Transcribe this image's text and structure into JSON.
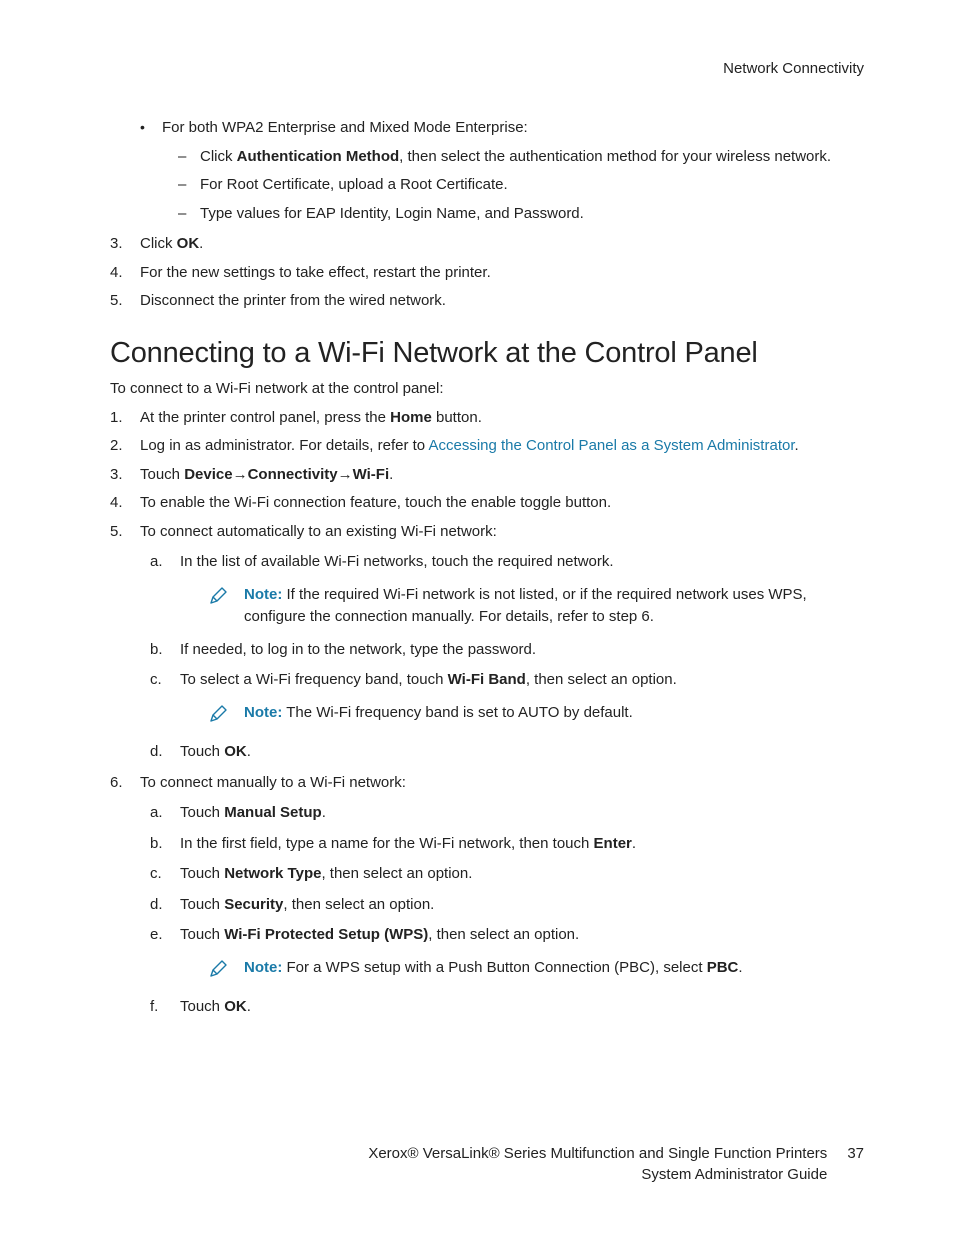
{
  "header": {
    "section": "Network Connectivity"
  },
  "top": {
    "bullet_intro": "For both WPA2 Enterprise and Mixed Mode Enterprise:",
    "dash": {
      "d1a": "Click ",
      "d1b": "Authentication Method",
      "d1c": ", then select the authentication method for your wireless network.",
      "d2": "For Root Certificate, upload a Root Certificate.",
      "d3": "Type values for EAP Identity, Login Name, and Password."
    },
    "n3a": "Click ",
    "n3b": "OK",
    "n3c": ".",
    "n4": "For the new settings to take effect, restart the printer.",
    "n5": "Disconnect the printer from the wired network."
  },
  "section": {
    "title": "Connecting to a Wi-Fi Network at the Control Panel",
    "intro": "To connect to a Wi-Fi network at the control panel:",
    "s1a": "At the printer control panel, press the ",
    "s1b": "Home",
    "s1c": " button.",
    "s2a": "Log in as administrator. For details, refer to ",
    "s2link": "Accessing the Control Panel as a System Administrator",
    "s2b": ".",
    "s3a": "Touch ",
    "s3b": "Device→Connectivity→Wi-Fi",
    "s3c": ".",
    "s4": "To enable the Wi-Fi connection feature, touch the enable toggle button.",
    "s5": "To connect automatically to an existing Wi-Fi network:",
    "s5a": "In the list of available Wi-Fi networks, touch the required network.",
    "note1_label": "Note:",
    "note1_text": " If the required Wi-Fi network is not listed, or if the required network uses WPS, configure the connection manually. For details, refer to step 6.",
    "s5b": "If needed, to log in to the network, type the password.",
    "s5c_a": "To select a Wi-Fi frequency band, touch ",
    "s5c_b": "Wi-Fi Band",
    "s5c_c": ", then select an option.",
    "note2_label": "Note:",
    "note2_text": " The Wi-Fi frequency band is set to AUTO by default.",
    "s5d_a": "Touch ",
    "s5d_b": "OK",
    "s5d_c": ".",
    "s6": "To connect manually to a Wi-Fi network:",
    "s6a_a": "Touch ",
    "s6a_b": "Manual Setup",
    "s6a_c": ".",
    "s6b_a": "In the first field, type a name for the Wi-Fi network, then touch ",
    "s6b_b": "Enter",
    "s6b_c": ".",
    "s6c_a": "Touch ",
    "s6c_b": "Network Type",
    "s6c_c": ", then select an option.",
    "s6d_a": "Touch ",
    "s6d_b": "Security",
    "s6d_c": ", then select an option.",
    "s6e_a": "Touch ",
    "s6e_b": "Wi-Fi Protected Setup (WPS)",
    "s6e_c": ", then select an option.",
    "note3_label": "Note:",
    "note3_a": " For a WPS setup with a Push Button Connection (PBC), select ",
    "note3_b": "PBC",
    "note3_c": ".",
    "s6f_a": "Touch ",
    "s6f_b": "OK",
    "s6f_c": "."
  },
  "footer": {
    "line1": "Xerox® VersaLink® Series Multifunction and Single Function Printers",
    "line2": "System Administrator Guide",
    "page": "37"
  },
  "markers": {
    "n3": "3.",
    "n4": "4.",
    "n5": "5.",
    "m1": "1.",
    "m2": "2.",
    "m3": "3.",
    "m4": "4.",
    "m5": "5.",
    "m6": "6.",
    "a": "a.",
    "b": "b.",
    "c": "c.",
    "d": "d.",
    "e": "e.",
    "f": "f."
  }
}
